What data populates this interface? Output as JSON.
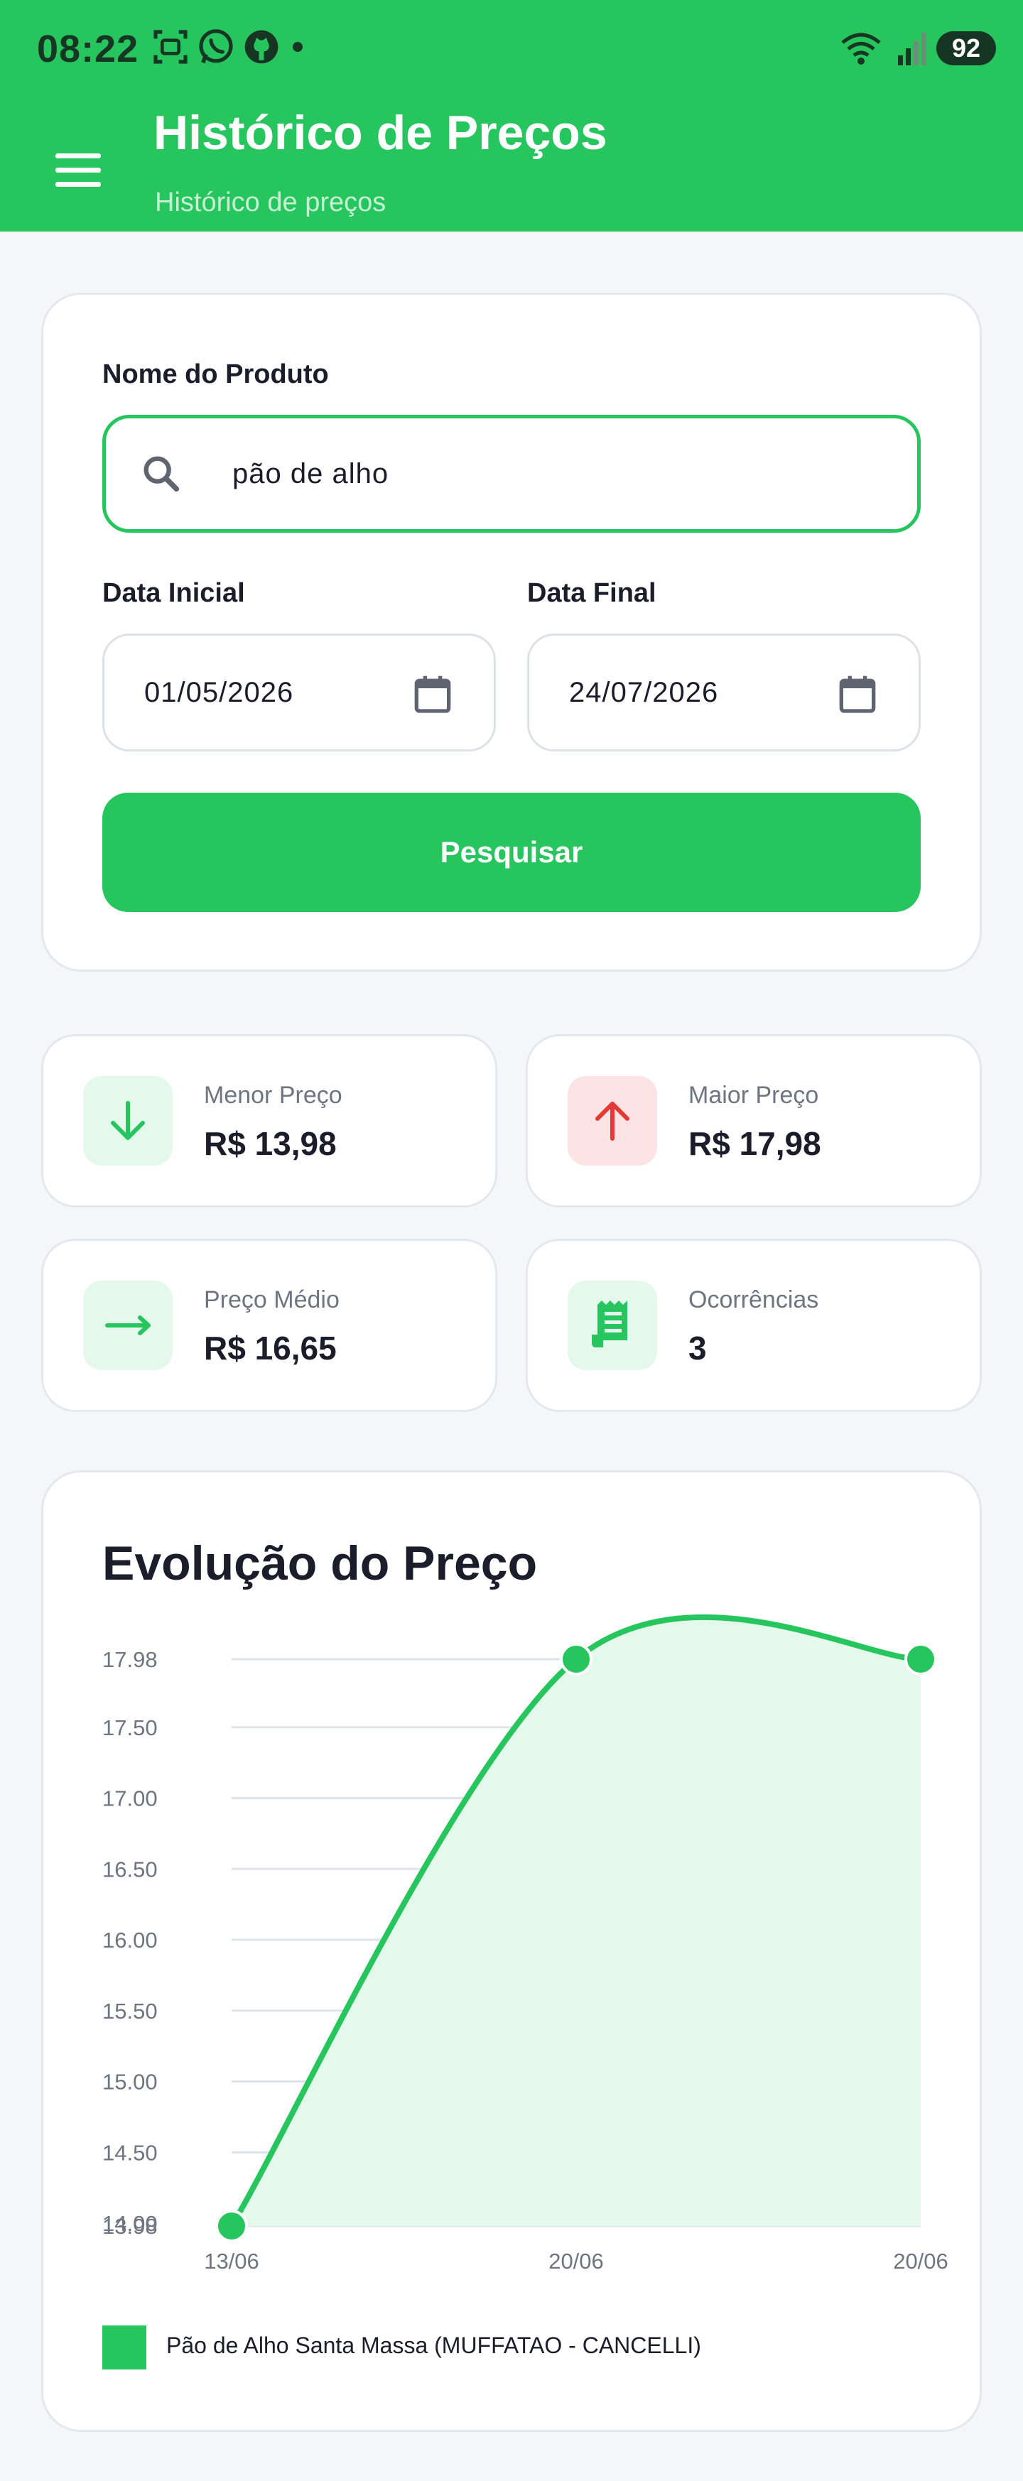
{
  "status_bar": {
    "time": "08:22",
    "battery": "92"
  },
  "header": {
    "title": "Histórico de Preços",
    "subtitle": "Histórico de preços"
  },
  "search": {
    "product_label": "Nome do Produto",
    "product_value": "pão de alho",
    "start_label": "Data Inicial",
    "start_value": "01/05/2026",
    "end_label": "Data Final",
    "end_value": "24/07/2026",
    "button_label": "Pesquisar"
  },
  "stats": {
    "min": {
      "label": "Menor Preço",
      "value": "R$ 13,98"
    },
    "max": {
      "label": "Maior Preço",
      "value": "R$ 17,98"
    },
    "avg": {
      "label": "Preço Médio",
      "value": "R$ 16,65"
    },
    "count": {
      "label": "Ocorrências",
      "value": "3"
    }
  },
  "colors": {
    "accent": "#26c55e",
    "accent_light": "#e5f8ec",
    "danger": "#e53935",
    "danger_light": "#fde3e3"
  },
  "chart_data": {
    "type": "area",
    "title": "Evolução do Preço",
    "x": [
      "13/06",
      "20/06",
      "20/06"
    ],
    "y_ticks": [
      "17.98",
      "17.50",
      "17.00",
      "16.50",
      "16.00",
      "15.50",
      "15.00",
      "14.50",
      "14.00",
      "13.98"
    ],
    "ylim": [
      13.98,
      17.98
    ],
    "grid": true,
    "legend_position": "bottom-left",
    "series": [
      {
        "name": "Pão de Alho Santa Massa (MUFFATAO - CANCELLI)",
        "values": [
          13.98,
          17.98,
          17.98
        ]
      }
    ]
  }
}
